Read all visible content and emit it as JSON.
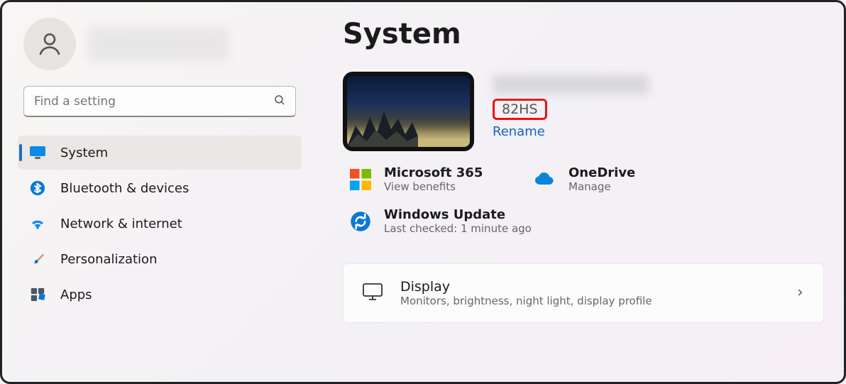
{
  "search": {
    "placeholder": "Find a setting"
  },
  "nav": {
    "system": "System",
    "bluetooth": "Bluetooth & devices",
    "network": "Network & internet",
    "personalization": "Personalization",
    "apps": "Apps"
  },
  "page": {
    "title": "System"
  },
  "device": {
    "model": "82HS",
    "rename": "Rename"
  },
  "quick": {
    "m365": {
      "title": "Microsoft 365",
      "sub": "View benefits"
    },
    "onedrive": {
      "title": "OneDrive",
      "sub": "Manage"
    },
    "update": {
      "title": "Windows Update",
      "sub": "Last checked: 1 minute ago"
    }
  },
  "cards": {
    "display": {
      "title": "Display",
      "sub": "Monitors, brightness, night light, display profile"
    }
  }
}
